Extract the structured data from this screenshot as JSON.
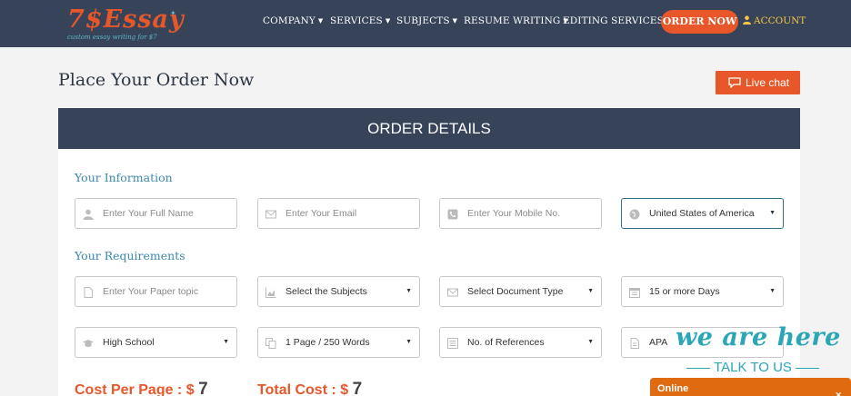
{
  "brand": {
    "logo_text": "7$Essay",
    "tagline": "custom essay writing for $7"
  },
  "nav": {
    "items": [
      {
        "label": "COMPANY"
      },
      {
        "label": "SERVICES"
      },
      {
        "label": "SUBJECTS"
      },
      {
        "label": "RESUME WRITING"
      },
      {
        "label": "EDITING SERVICES"
      }
    ],
    "order_now": "ORDER NOW",
    "account": "ACCOUNT"
  },
  "page": {
    "title": "Place Your Order Now",
    "live_chat": "Live chat"
  },
  "order": {
    "header": "ORDER DETAILS",
    "your_information": "Your Information",
    "your_requirements": "Your Requirements",
    "info_fields": {
      "full_name_placeholder": "Enter Your Full Name",
      "email_placeholder": "Enter Your Email",
      "mobile_placeholder": "Enter Your Mobile No.",
      "country_value": "United States of America"
    },
    "req_fields": {
      "topic_placeholder": "Enter Your Paper topic",
      "subjects": "Select the Subjects",
      "document_type": "Select Document Type",
      "deadline": "15 or more Days",
      "level": "High School",
      "pages": "1 Page / 250 Words",
      "references": "No. of References",
      "style": "APA"
    },
    "cost_per_page_label": "Cost Per Page : $",
    "cost_per_page_value": "7",
    "total_cost_label": "Total Cost : $",
    "total_cost_value": "7"
  },
  "chat_widget": {
    "headline": "we are here",
    "subline": "TALK TO US",
    "status": "Online"
  },
  "colors": {
    "header_bg": "#364359",
    "accent": "#e8572a",
    "teal": "#2aa6b5",
    "account": "#f6c744"
  }
}
